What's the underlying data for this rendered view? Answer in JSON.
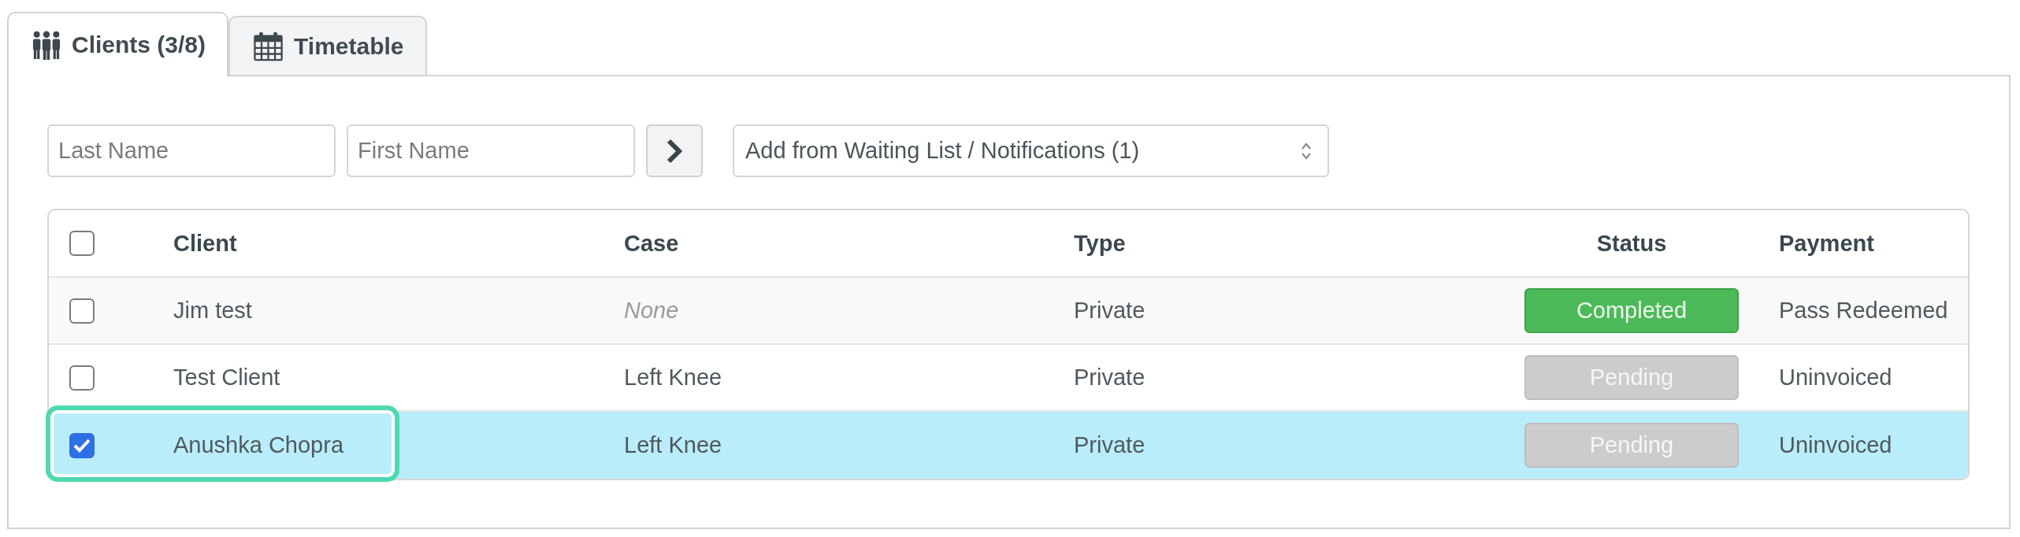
{
  "tabs": [
    {
      "label": "Clients (3/8)",
      "selected": true
    },
    {
      "label": "Timetable",
      "selected": false
    }
  ],
  "search": {
    "last_name": {
      "placeholder": "Last Name"
    },
    "first_name": {
      "placeholder": "First Name"
    },
    "waiting_list": {
      "value": "Add from Waiting List / Notifications (1)"
    }
  },
  "table": {
    "select_all": {
      "checked": false
    },
    "columns": [
      "Client",
      "Case",
      "Type",
      "Status",
      "Payment"
    ],
    "rows": [
      {
        "checked": false,
        "selected": false,
        "outlined": false,
        "client": "Jim test",
        "case": {
          "text": "None",
          "muted": true
        },
        "type": "Private",
        "status": {
          "label": "Completed",
          "kind": "completed"
        },
        "payment": "Pass Redeemed"
      },
      {
        "checked": false,
        "selected": false,
        "outlined": false,
        "client": "Test Client",
        "case": {
          "text": "Left Knee",
          "muted": false
        },
        "type": "Private",
        "status": {
          "label": "Pending",
          "kind": "pending"
        },
        "payment": "Uninvoiced"
      },
      {
        "checked": true,
        "selected": true,
        "outlined": true,
        "client": "Anushka Chopra",
        "case": {
          "text": "Left Knee",
          "muted": false
        },
        "type": "Private",
        "status": {
          "label": "Pending",
          "kind": "pending"
        },
        "payment": "Uninvoiced"
      }
    ]
  }
}
